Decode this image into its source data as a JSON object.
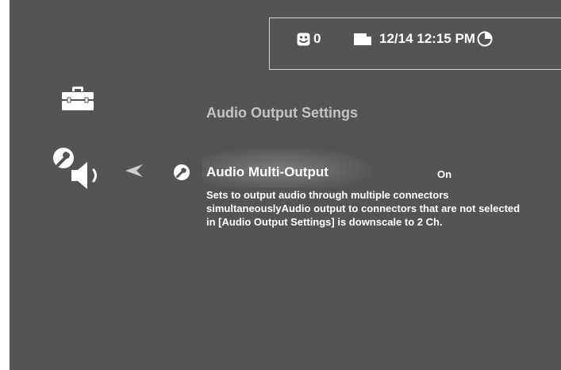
{
  "status_bar": {
    "smiley_count": "0",
    "datetime": "12/14 12:15 PM",
    "icons": [
      "smiley-icon",
      "film-icon",
      "clock-icon"
    ]
  },
  "menu": {
    "category_icon": "toolbox-icon",
    "section_title": "Audio Output Settings",
    "current_icon": "wrench-speaker-icon",
    "back_icon": "back-arrow-icon",
    "setting": {
      "icon": "wrench-icon",
      "name": "Audio Multi-Output",
      "value": "On",
      "description": "Sets to output audio through multiple connectors simultaneouslyAudio output to connectors that are not selected in [Audio Output Settings] is downscale to 2 Ch."
    }
  },
  "colors": {
    "background": "#545454",
    "text": "#ffffff",
    "title": "#c4c4c4",
    "border": "#d6d6d6"
  }
}
